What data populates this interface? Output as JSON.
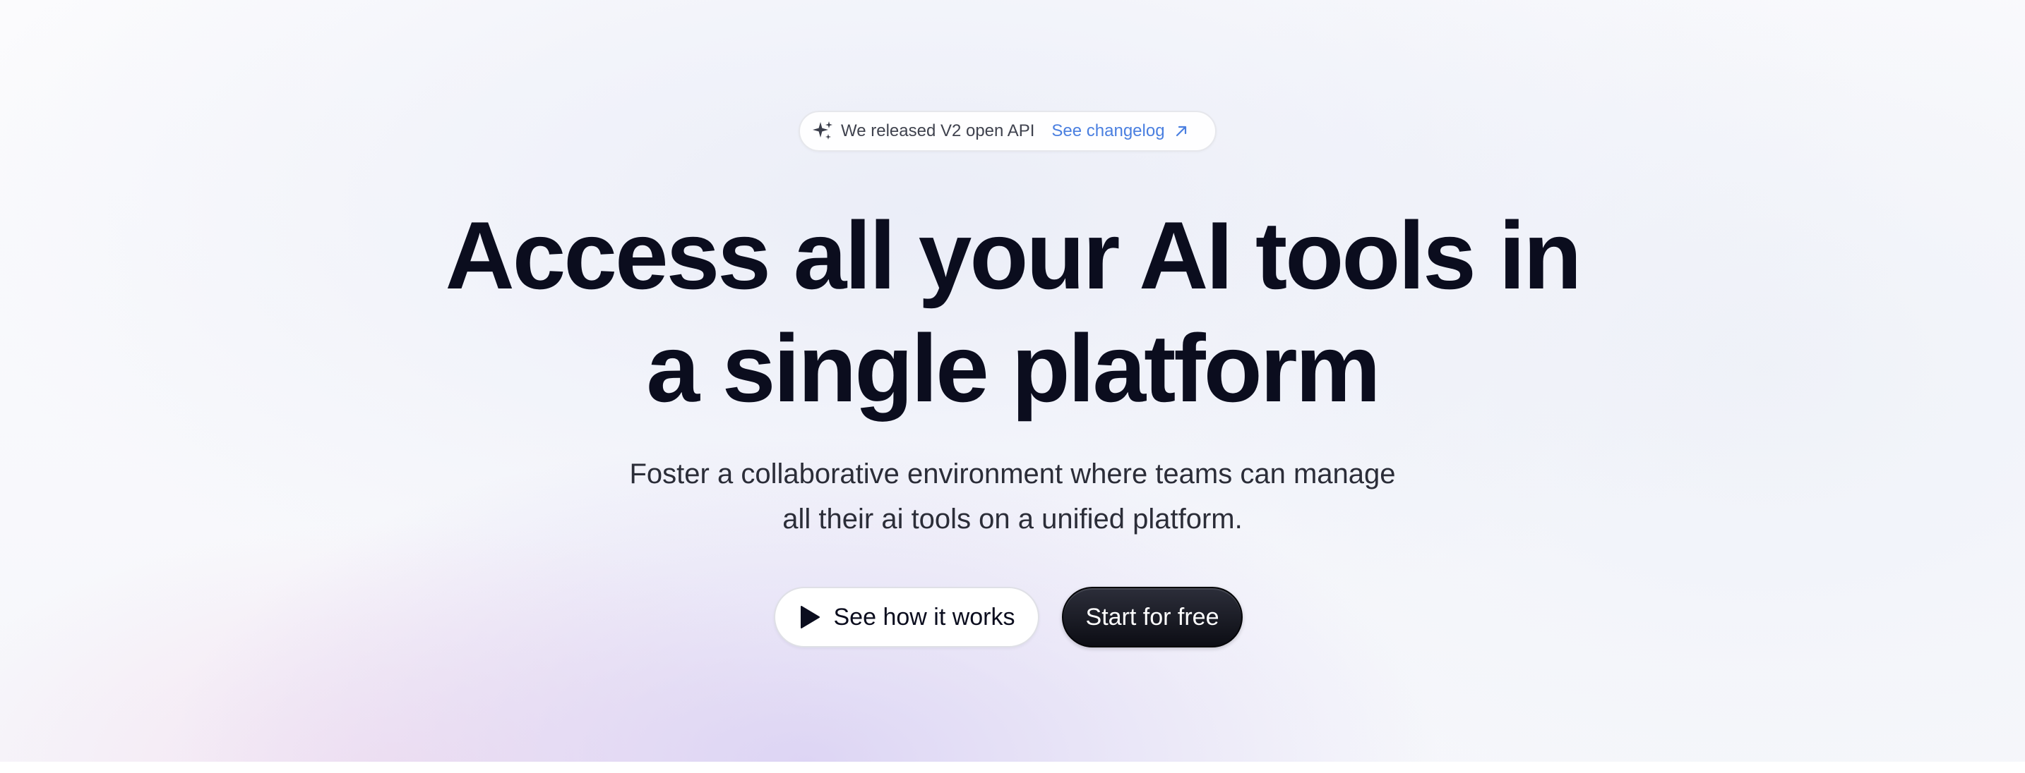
{
  "announcement": {
    "icon": "sparkle-icon",
    "message": "We released V2 open API",
    "link_label": "See changelog",
    "link_icon": "arrow-up-right-icon",
    "link_color": "#4a7fe0"
  },
  "hero": {
    "headline_line1": "Access all your AI tools in",
    "headline_line2": "a single platform",
    "subtitle_line1": "Foster a collaborative environment where teams can manage",
    "subtitle_line2": "all their ai tools on a unified platform."
  },
  "actions": {
    "secondary_label": "See how it works",
    "secondary_icon": "play-icon",
    "primary_label": "Start for free"
  },
  "colors": {
    "heading": "#0b0d1e",
    "body_text": "#2b2d38",
    "primary_button": "#0c0d14",
    "accent_link": "#4a7fe0"
  }
}
